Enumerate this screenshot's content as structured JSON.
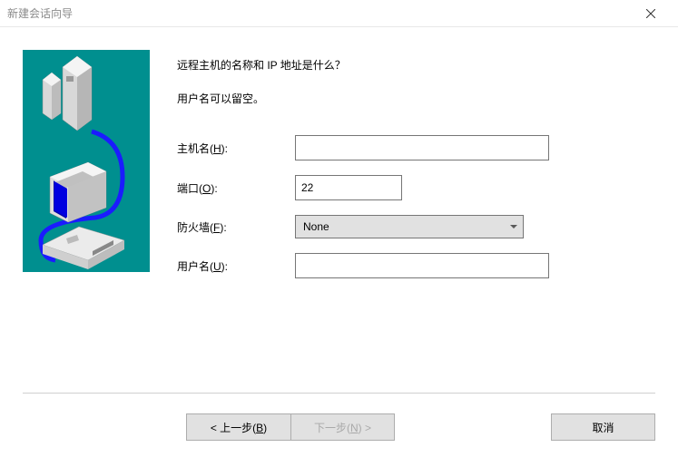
{
  "titlebar": {
    "title": "新建会话向导"
  },
  "intro": {
    "heading": "远程主机的名称和 IP 地址是什么？",
    "sub": "用户名可以留空。"
  },
  "form": {
    "hostname": {
      "label_pre": "主机名(",
      "label_key": "H",
      "label_post": "):",
      "value": ""
    },
    "port": {
      "label_pre": "端口(",
      "label_key": "O",
      "label_post": "):",
      "value": "22"
    },
    "firewall": {
      "label_pre": "防火墙(",
      "label_key": "F",
      "label_post": "):",
      "selected": "None"
    },
    "username": {
      "label_pre": "用户名(",
      "label_key": "U",
      "label_post": "):",
      "value": ""
    }
  },
  "buttons": {
    "back_pre": "< 上一步(",
    "back_key": "B",
    "back_post": ")",
    "next_pre": "下一步(",
    "next_key": "N",
    "next_post": ") >",
    "cancel": "取消"
  }
}
